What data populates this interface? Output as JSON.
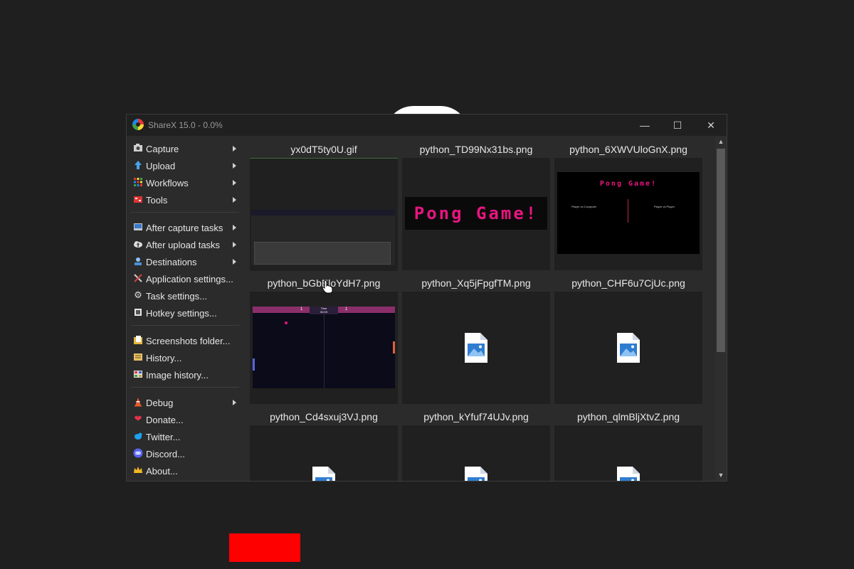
{
  "window": {
    "title": "ShareX 15.0 - 0.0%",
    "controls": {
      "minimize": "—",
      "maximize": "☐",
      "close": "✕"
    }
  },
  "menu": {
    "main": [
      {
        "label": "Capture",
        "icon": "camera-icon",
        "submenu": true
      },
      {
        "label": "Upload",
        "icon": "upload-arrow-icon",
        "submenu": true
      },
      {
        "label": "Workflows",
        "icon": "workflows-grid-icon",
        "submenu": true
      },
      {
        "label": "Tools",
        "icon": "tools-icon",
        "submenu": true
      }
    ],
    "settings": [
      {
        "label": "After capture tasks",
        "icon": "after-capture-icon",
        "submenu": true
      },
      {
        "label": "After upload tasks",
        "icon": "cloud-upload-icon",
        "submenu": true
      },
      {
        "label": "Destinations",
        "icon": "destinations-icon",
        "submenu": true
      },
      {
        "label": "Application settings...",
        "icon": "wrench-screwdriver-icon",
        "submenu": false
      },
      {
        "label": "Task settings...",
        "icon": "gear-icon",
        "submenu": false
      },
      {
        "label": "Hotkey settings...",
        "icon": "keyboard-icon",
        "submenu": false
      }
    ],
    "folders": [
      {
        "label": "Screenshots folder...",
        "icon": "folder-icon",
        "submenu": false
      },
      {
        "label": "History...",
        "icon": "history-icon",
        "submenu": false
      },
      {
        "label": "Image history...",
        "icon": "image-history-icon",
        "submenu": false
      }
    ],
    "misc": [
      {
        "label": "Debug",
        "icon": "traffic-cone-icon",
        "submenu": true
      },
      {
        "label": "Donate...",
        "icon": "heart-icon",
        "submenu": false
      },
      {
        "label": "Twitter...",
        "icon": "twitter-bird-icon",
        "submenu": false
      },
      {
        "label": "Discord...",
        "icon": "discord-icon",
        "submenu": false
      },
      {
        "label": "About...",
        "icon": "crown-icon",
        "submenu": false
      }
    ]
  },
  "files": [
    {
      "name": "yx0dT5ty0U.gif",
      "preview": "desktop-screenshot"
    },
    {
      "name": "python_TD99Nx31bs.png",
      "preview": "pong-banner",
      "text": "Pong Game!"
    },
    {
      "name": "python_6XWVUloGnX.png",
      "preview": "pong-menu",
      "text": "Pong Game!",
      "left_option": "Player vs Computer",
      "right_option": "Player vs Player"
    },
    {
      "name": "python_bGbEloYdH7.png",
      "preview": "pong-gameplay",
      "score_left": "1",
      "score_right": "1",
      "timer_label": "Time",
      "timer_value": "00:09"
    },
    {
      "name": "python_Xq5jFpgfTM.png",
      "preview": "file-icon"
    },
    {
      "name": "python_CHF6u7CjUc.png",
      "preview": "file-icon"
    },
    {
      "name": "python_Cd4sxuj3VJ.png",
      "preview": "file-icon"
    },
    {
      "name": "python_kYfuf74UJv.png",
      "preview": "file-icon"
    },
    {
      "name": "python_qlmBljXtvZ.png",
      "preview": "file-icon"
    }
  ],
  "colors": {
    "pong_pink": "#e8157f",
    "window_bg": "#2b2b2b",
    "tile_bg": "#202020",
    "highlight_red": "#ff0000"
  }
}
